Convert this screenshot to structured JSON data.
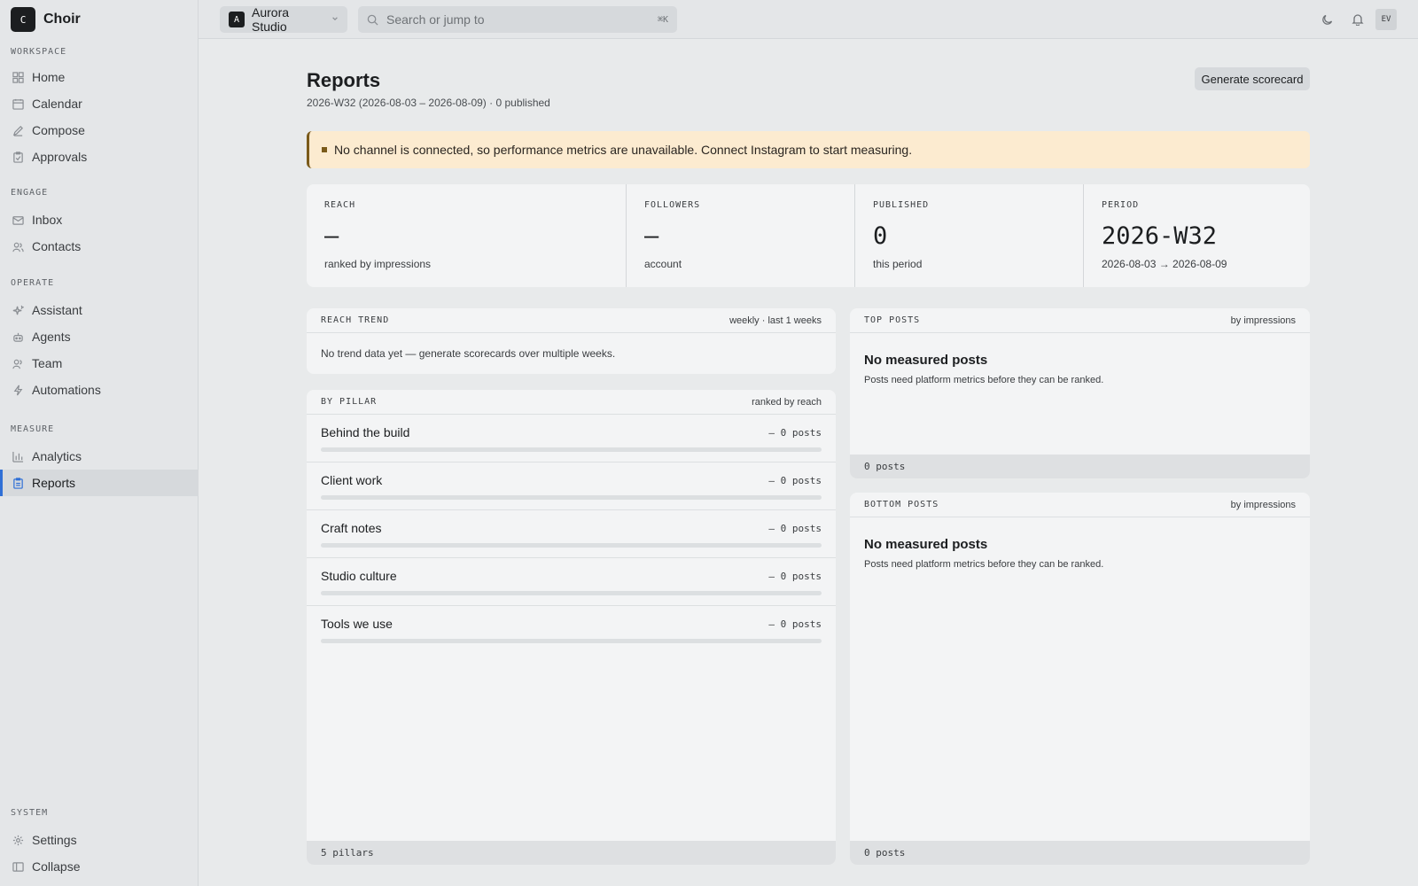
{
  "app": {
    "logo_letter": "C",
    "name": "Choir"
  },
  "sidebar": {
    "groups": [
      {
        "heading": "WORKSPACE",
        "items": [
          {
            "label": "Home",
            "icon": "grid-icon"
          },
          {
            "label": "Calendar",
            "icon": "calendar-icon"
          },
          {
            "label": "Compose",
            "icon": "pen-icon"
          },
          {
            "label": "Approvals",
            "icon": "clipboard-check-icon"
          }
        ]
      },
      {
        "heading": "ENGAGE",
        "items": [
          {
            "label": "Inbox",
            "icon": "inbox-icon"
          },
          {
            "label": "Contacts",
            "icon": "users-icon"
          }
        ]
      },
      {
        "heading": "OPERATE",
        "items": [
          {
            "label": "Assistant",
            "icon": "sparkle-icon"
          },
          {
            "label": "Agents",
            "icon": "bot-icon"
          },
          {
            "label": "Team",
            "icon": "team-icon"
          },
          {
            "label": "Automations",
            "icon": "bolt-icon"
          }
        ]
      },
      {
        "heading": "MEASURE",
        "items": [
          {
            "label": "Analytics",
            "icon": "bar-chart-icon"
          },
          {
            "label": "Reports",
            "icon": "report-icon",
            "active": true
          }
        ]
      },
      {
        "heading": "SYSTEM",
        "items": [
          {
            "label": "Settings",
            "icon": "gear-icon"
          },
          {
            "label": "Collapse",
            "icon": "sidebar-collapse-icon"
          }
        ]
      }
    ]
  },
  "topbar": {
    "workspace_badge": "A",
    "workspace_name": "Aurora Studio",
    "search_placeholder": "Search or jump to",
    "search_shortcut": "⌘K",
    "avatar_initials": "EV"
  },
  "page": {
    "title": "Reports",
    "subtitle": "2026-W32 (2026-08-03 – 2026-08-09) · 0 published",
    "generate_button": "Generate scorecard",
    "alert": "No channel is connected, so performance metrics are unavailable. Connect Instagram to start measuring."
  },
  "stats": [
    {
      "label": "REACH",
      "value": "—",
      "note": "ranked by impressions"
    },
    {
      "label": "FOLLOWERS",
      "value": "–",
      "note": "account"
    },
    {
      "label": "PUBLISHED",
      "value": "0",
      "note": "this period"
    },
    {
      "label": "PERIOD",
      "value": "2026-W32",
      "note": "2026-08-03 → 2026-08-09"
    }
  ],
  "reach_trend": {
    "title": "REACH TREND",
    "meta": "weekly · last 1 weeks",
    "empty": "No trend data yet — generate scorecards over multiple weeks."
  },
  "by_pillar": {
    "title": "BY PILLAR",
    "meta": "ranked by reach",
    "rows": [
      {
        "name": "Behind the build",
        "count": "— 0 posts",
        "fill": 0
      },
      {
        "name": "Client work",
        "count": "— 0 posts",
        "fill": 0
      },
      {
        "name": "Craft notes",
        "count": "— 0 posts",
        "fill": 0
      },
      {
        "name": "Studio culture",
        "count": "— 0 posts",
        "fill": 0
      },
      {
        "name": "Tools we use",
        "count": "— 0 posts",
        "fill": 0
      }
    ],
    "footer": "5 pillars"
  },
  "top_posts": {
    "title": "TOP POSTS",
    "meta": "by impressions",
    "empty_title": "No measured posts",
    "empty_desc": "Posts need platform metrics before they can be ranked.",
    "footer": "0 posts"
  },
  "bottom_posts": {
    "title": "BOTTOM POSTS",
    "meta": "by impressions",
    "empty_title": "No measured posts",
    "empty_desc": "Posts need platform metrics before they can be ranked.",
    "footer": "0 posts"
  },
  "colors": {
    "accent": "#2f6fd6",
    "alert_bg": "#fcebd0",
    "alert_border": "#7a5a1a"
  }
}
